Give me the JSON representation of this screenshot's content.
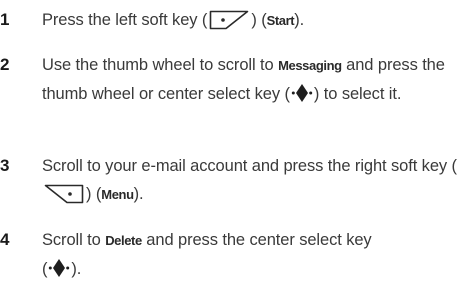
{
  "steps": [
    {
      "number": "1",
      "t1": "Press the left soft key (",
      "t2": ") (",
      "term": "Start",
      "t3": ")."
    },
    {
      "number": "2",
      "t1": "Use the thumb wheel to scroll to ",
      "term": "Messaging",
      "t2": " and press the thumb wheel or center select key (",
      "t3": ") to select it."
    },
    {
      "number": "3",
      "t1": "Scroll to your e-mail account and press the right soft key (",
      "t2": ") (",
      "term": "Menu",
      "t3": ")."
    },
    {
      "number": "4",
      "t1": "Scroll to ",
      "term": "Delete",
      "t2": " and press the center select key (",
      "t3": ")."
    }
  ],
  "icons": {
    "left_soft_key": "left-soft-key-icon",
    "right_soft_key": "right-soft-key-icon",
    "center_select_key": "center-select-key-icon"
  }
}
